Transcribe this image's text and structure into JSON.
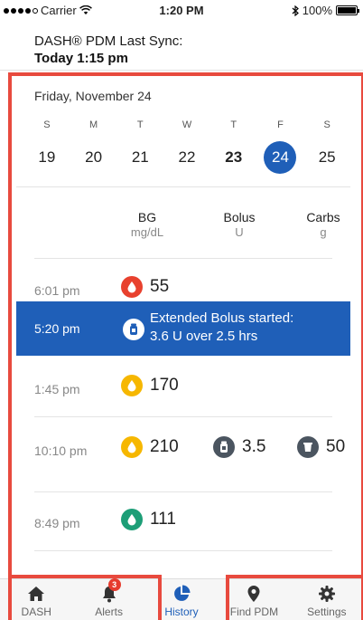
{
  "status_bar": {
    "carrier": "Carrier",
    "time": "1:20 PM",
    "battery": "100%"
  },
  "header": {
    "title": "DASH® PDM Last Sync:",
    "sync_time": "Today 1:15 pm"
  },
  "calendar": {
    "date_title": "Friday, November 24",
    "weekdays": [
      "S",
      "M",
      "T",
      "W",
      "T",
      "F",
      "S"
    ],
    "days": [
      "19",
      "20",
      "21",
      "22",
      "23",
      "24",
      "25"
    ],
    "selected_index": 5
  },
  "columns": {
    "bg": {
      "title": "BG",
      "unit": "mg/dL"
    },
    "bolus": {
      "title": "Bolus",
      "unit": "U"
    },
    "carbs": {
      "title": "Carbs",
      "unit": "g"
    }
  },
  "entries": [
    {
      "time": "6:01 pm",
      "bg": "55",
      "bg_color": "#e8412e"
    },
    {
      "time": "5:20 pm",
      "event_line1": "Extended Bolus started:",
      "event_line2": "3.6 U over 2.5 hrs"
    },
    {
      "time": "1:45 pm",
      "bg": "170",
      "bg_color": "#f6b700"
    },
    {
      "time": "10:10 pm",
      "bg": "210",
      "bg_color": "#f6b700",
      "bolus": "3.5",
      "carbs": "50"
    },
    {
      "time": "8:49 pm",
      "bg": "111",
      "bg_color": "#1d9e77"
    }
  ],
  "tabs": [
    {
      "label": "DASH",
      "icon": "home-icon"
    },
    {
      "label": "Alerts",
      "icon": "bell-icon",
      "badge": "3"
    },
    {
      "label": "History",
      "icon": "pie-chart-icon",
      "active": true
    },
    {
      "label": "Find PDM",
      "icon": "location-pin-icon"
    },
    {
      "label": "Settings",
      "icon": "gear-icon"
    }
  ],
  "colors": {
    "accent": "#1f5fb8",
    "annotation": "#e84a3e",
    "bg_low": "#e8412e",
    "bg_high": "#f6b700",
    "bg_normal": "#1d9e77"
  }
}
